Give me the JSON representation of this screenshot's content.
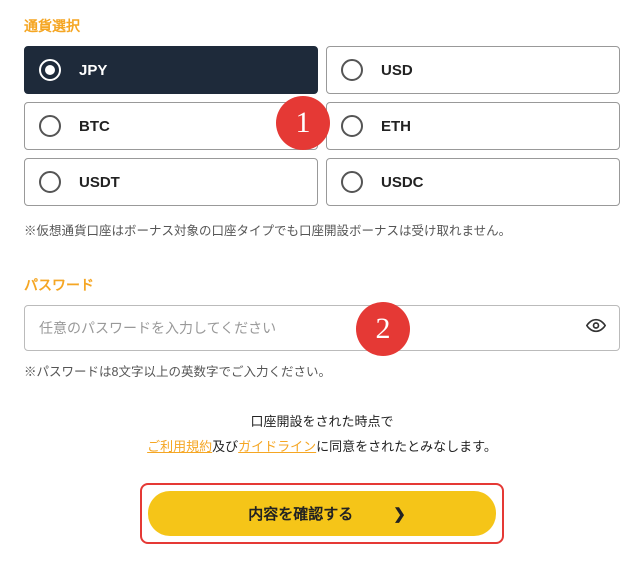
{
  "currency": {
    "label": "通貨選択",
    "options": [
      "JPY",
      "USD",
      "BTC",
      "ETH",
      "USDT",
      "USDC"
    ],
    "selected": "JPY",
    "note": "※仮想通貨口座はボーナス対象の口座タイプでも口座開設ボーナスは受け取れません。"
  },
  "password": {
    "label": "パスワード",
    "placeholder": "任意のパスワードを入力してください",
    "hint": "※パスワードは8文字以上の英数字でご入力ください。"
  },
  "terms": {
    "line1": "口座開設をされた時点で",
    "link1": "ご利用規約",
    "mid": "及び",
    "link2": "ガイドライン",
    "line2_tail": "に同意をされたとみなします。"
  },
  "submit": {
    "label": "内容を確認する"
  },
  "callouts": {
    "one": "1",
    "two": "2"
  }
}
